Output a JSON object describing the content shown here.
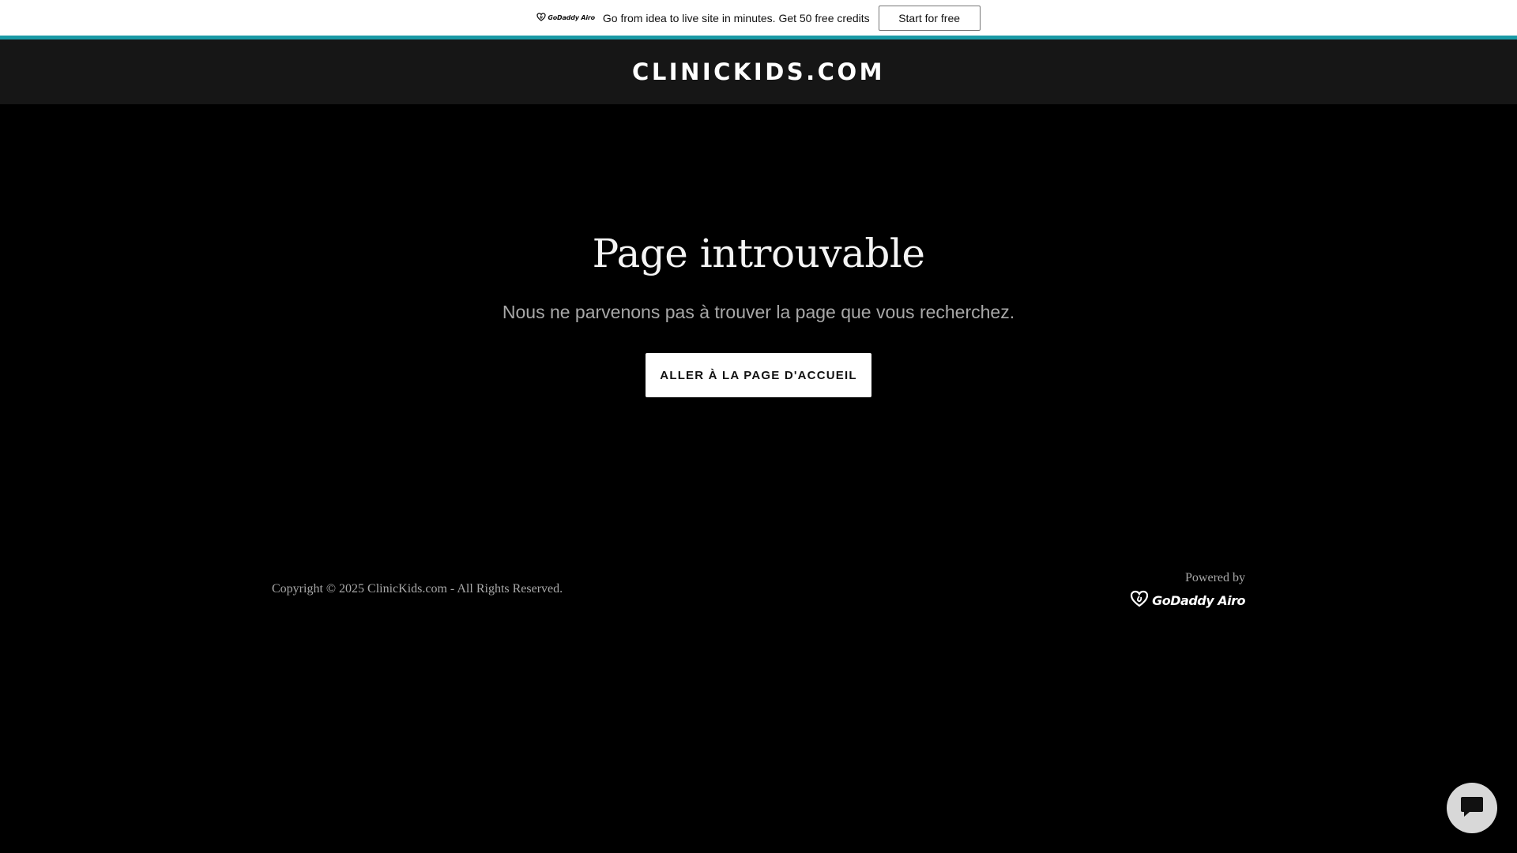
{
  "promo": {
    "logo_text": "GoDaddy Airo",
    "message": "Go from idea to live site in minutes. Get 50 free credits",
    "button_label": "Start for free"
  },
  "header": {
    "site_title": "CLINICKIDS.COM"
  },
  "main": {
    "heading": "Page introuvable",
    "subtext": "Nous ne parvenons pas à trouver la page que vous recherchez.",
    "home_button_label": "ALLER À LA PAGE D'ACCUEIL"
  },
  "footer": {
    "copyright": "Copyright © 2025 ClinicKids.com - All Rights Reserved.",
    "powered_by": "Powered by",
    "brand_logo_text": "GoDaddy Airo"
  },
  "chat": {
    "icon": "chat-bubble-icon"
  },
  "colors": {
    "accent": "#1a9aa6",
    "page_background": "#000000",
    "header_background": "#161616"
  }
}
